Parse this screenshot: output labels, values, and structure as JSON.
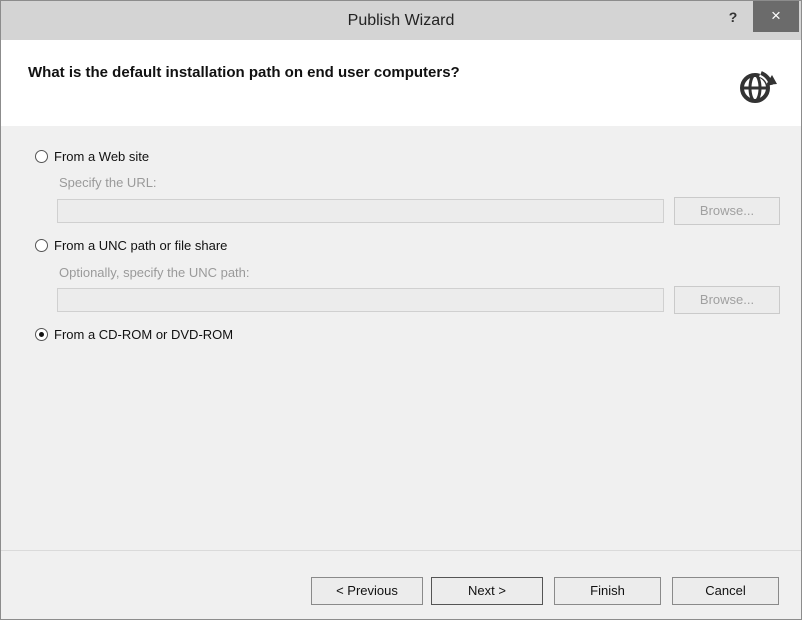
{
  "window": {
    "title": "Publish Wizard",
    "help_label": "?",
    "close_label": "×"
  },
  "header": {
    "question": "What is the default installation path on end user computers?",
    "icon": "globe-arrow-icon"
  },
  "options": {
    "web": {
      "label": "From a Web site",
      "selected": false,
      "sublabel": "Specify the URL:",
      "value": "",
      "browse_label": "Browse..."
    },
    "unc": {
      "label": "From a UNC path or file share",
      "selected": false,
      "sublabel": "Optionally, specify the UNC path:",
      "value": "",
      "browse_label": "Browse..."
    },
    "cd": {
      "label": "From a CD-ROM or DVD-ROM",
      "selected": true
    }
  },
  "footer": {
    "previous_label": "< Previous",
    "next_label": "Next >",
    "finish_label": "Finish",
    "cancel_label": "Cancel"
  }
}
